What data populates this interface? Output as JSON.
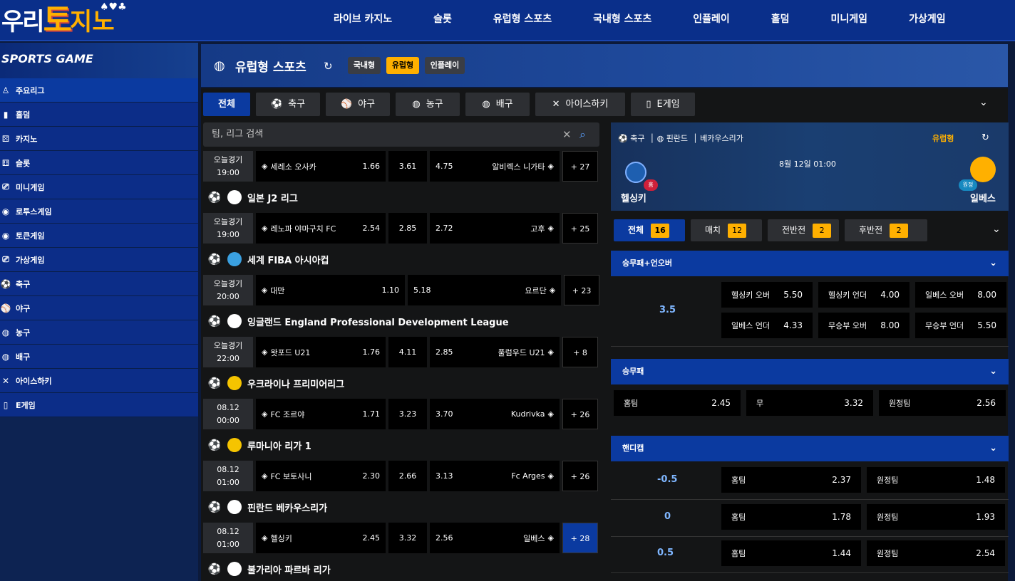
{
  "logo": {
    "part1": "우리",
    "part2": "토",
    "part3": "지노"
  },
  "nav": [
    "라이브 카지노",
    "슬롯",
    "유럽형 스포츠",
    "국내형 스포츠",
    "인플레이",
    "홀덤",
    "미니게임",
    "가상게임"
  ],
  "sidebar": {
    "title": "SPORTS GAME",
    "items": [
      {
        "label": "주요리그",
        "icon": "♙"
      },
      {
        "label": "홀덤",
        "icon": "▮"
      },
      {
        "label": "카지노",
        "icon": "⚄"
      },
      {
        "label": "슬롯",
        "icon": "⚅"
      },
      {
        "label": "미니게임",
        "icon": "⎚"
      },
      {
        "label": "로투스게임",
        "icon": "◉"
      },
      {
        "label": "토큰게임",
        "icon": "◉"
      },
      {
        "label": "가상게임",
        "icon": "⎚"
      },
      {
        "label": "축구",
        "icon": "⚽"
      },
      {
        "label": "야구",
        "icon": "⚾"
      },
      {
        "label": "농구",
        "icon": "◍"
      },
      {
        "label": "배구",
        "icon": "◍"
      },
      {
        "label": "아이스하키",
        "icon": "✕"
      },
      {
        "label": "E게임",
        "icon": "▯"
      }
    ]
  },
  "header": {
    "title": "유럽형 스포츠",
    "pills": [
      "국내형",
      "유럽형",
      "인플레이"
    ]
  },
  "tabs": [
    {
      "label": "전체",
      "icon": ""
    },
    {
      "label": "축구",
      "icon": "⚽"
    },
    {
      "label": "야구",
      "icon": "⚾"
    },
    {
      "label": "농구",
      "icon": "◍"
    },
    {
      "label": "배구",
      "icon": "◍"
    },
    {
      "label": "아이스하키",
      "icon": "✕"
    },
    {
      "label": "E게임",
      "icon": "▯"
    }
  ],
  "search": {
    "placeholder": "팀, 리그 검색"
  },
  "list": [
    {
      "match": {
        "day": "오늘경기",
        "time": "19:00",
        "home": "세레소 오사카",
        "o1": "1.66",
        "ox": "3.61",
        "o2": "4.75",
        "away": "알비렉스 니가타",
        "more": "+ 27"
      }
    },
    {
      "league": {
        "name": "일본  J2 리그",
        "flag": "#ffffff"
      }
    },
    {
      "match": {
        "day": "오늘경기",
        "time": "19:00",
        "home": "레노파 야마구치 FC",
        "o1": "2.54",
        "ox": "2.85",
        "o2": "2.72",
        "away": "고후",
        "more": "+ 25"
      }
    },
    {
      "league": {
        "name": "세계  FIBA 아시아컵",
        "flag": "#3aa0e0"
      }
    },
    {
      "match": {
        "day": "오늘경기",
        "time": "20:00",
        "home": "대만",
        "o1": "1.10",
        "ox": "",
        "o2": "5.18",
        "away": "요르단",
        "more": "+ 23"
      }
    },
    {
      "league": {
        "name": "잉글랜드  England Professional Development League",
        "flag": "#ffffff"
      }
    },
    {
      "match": {
        "day": "오늘경기",
        "time": "22:00",
        "home": "왓포드 U21",
        "o1": "1.76",
        "ox": "4.11",
        "o2": "2.85",
        "away": "풀럼우드 U21",
        "more": "+ 8"
      }
    },
    {
      "league": {
        "name": "우크라이나  프리미어리그",
        "flag": "#f5c400"
      }
    },
    {
      "match": {
        "day": "08.12",
        "time": "00:00",
        "home": "FC 조르야",
        "o1": "1.71",
        "ox": "3.23",
        "o2": "3.70",
        "away": "Kudrivka",
        "more": "+ 26"
      }
    },
    {
      "league": {
        "name": "루마니아  리가 1",
        "flag": "#f5c400"
      }
    },
    {
      "match": {
        "day": "08.12",
        "time": "01:00",
        "home": "FC 보토사니",
        "o1": "2.30",
        "ox": "2.66",
        "o2": "3.13",
        "away": "Fc Arges",
        "more": "+ 26"
      }
    },
    {
      "league": {
        "name": "핀란드  베카우스리가",
        "flag": "#ffffff"
      }
    },
    {
      "match": {
        "day": "08.12",
        "time": "01:00",
        "home": "헬싱키",
        "o1": "2.45",
        "ox": "3.32",
        "o2": "2.56",
        "away": "일베스",
        "more": "+ 28",
        "selected": true
      }
    },
    {
      "league": {
        "name": "불가리아  파르바 리가",
        "flag": "#ffffff"
      }
    }
  ],
  "detail": {
    "crumb": {
      "sport": "축구",
      "country": "핀란드",
      "league": "베카우스리가"
    },
    "type": "유럽형",
    "date": "8월 12일 01:00",
    "home": "헬싱키",
    "away": "일베스",
    "home_badge": "홈",
    "away_badge": "원정",
    "tabs": [
      {
        "label": "전체",
        "count": "16"
      },
      {
        "label": "매치",
        "count": "12"
      },
      {
        "label": "전반전",
        "count": "2"
      },
      {
        "label": "후반전",
        "count": "2"
      }
    ],
    "sections": {
      "ou": {
        "title": "승무패+언오버",
        "line": "3.5",
        "cells": [
          {
            "label": "헬싱키 오버",
            "odd": "5.50"
          },
          {
            "label": "헬싱키 언더",
            "odd": "4.00"
          },
          {
            "label": "일베스 오버",
            "odd": "8.00"
          },
          {
            "label": "일베스 언더",
            "odd": "4.33"
          },
          {
            "label": "무승부 오버",
            "odd": "8.00"
          },
          {
            "label": "무승부 언더",
            "odd": "5.50"
          }
        ]
      },
      "wdl": {
        "title": "승무패",
        "cells": [
          {
            "label": "홈팀",
            "odd": "2.45"
          },
          {
            "label": "무",
            "odd": "3.32"
          },
          {
            "label": "원정팀",
            "odd": "2.56"
          }
        ]
      },
      "hc": {
        "title": "핸디캡",
        "rows": [
          {
            "line": "-0.5",
            "home_label": "홈팀",
            "home": "2.37",
            "away_label": "원정팀",
            "away": "1.48"
          },
          {
            "line": "0",
            "home_label": "홈팀",
            "home": "1.78",
            "away_label": "원정팀",
            "away": "1.93"
          },
          {
            "line": "0.5",
            "home_label": "홈팀",
            "home": "1.44",
            "away_label": "원정팀",
            "away": "2.54"
          }
        ]
      }
    }
  },
  "colors": {
    "primary": "#0b3aa0",
    "accent": "#ffb000",
    "panel": "#141516",
    "cell": "#000000"
  }
}
